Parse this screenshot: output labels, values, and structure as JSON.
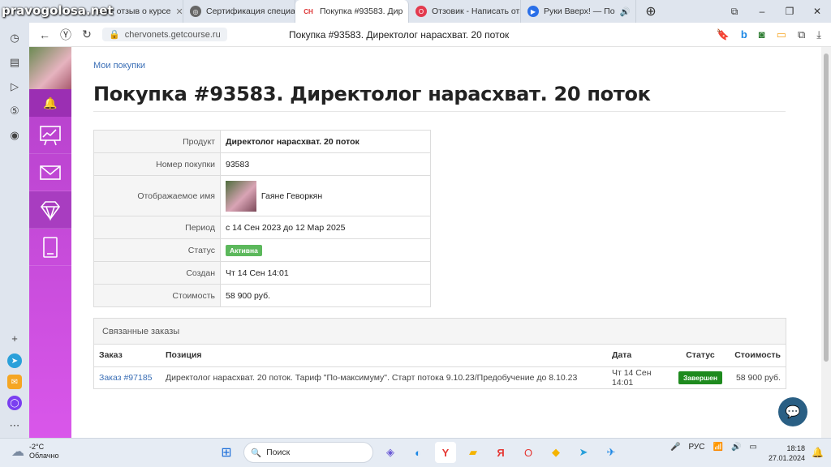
{
  "watermark": "pravogolosa.net",
  "tabs": [
    {
      "label": "вьте отзыв о курсе",
      "fav": "",
      "color": "#888"
    },
    {
      "label": "Сертификация специалиста",
      "fav": "◎",
      "color": "#555"
    },
    {
      "label": "Покупка #93583. Дир",
      "fav": "CH",
      "color": "#d33"
    },
    {
      "label": "Отзовик - Написать отз",
      "fav": "O",
      "color": "#e33a4e"
    },
    {
      "label": "Руки Вверх! — По",
      "fav": "▶",
      "color": "#2a6fe8"
    }
  ],
  "addressbar": {
    "url": "chervonets.getcourse.ru",
    "page_title": "Покупка #93583. Директолог нарасхват. 20 поток"
  },
  "page": {
    "breadcrumb": "Мои покупки",
    "title": "Покупка #93583. Директолог нарасхват. 20 поток",
    "info": {
      "product_label": "Продукт",
      "product_value": "Директолог нарасхват. 20 поток",
      "number_label": "Номер покупки",
      "number_value": "93583",
      "name_label": "Отображаемое имя",
      "name_value": "Гаяне Геворкян",
      "period_label": "Период",
      "period_value": "с 14 Сен 2023 до 12 Мар 2025",
      "status_label": "Статус",
      "status_value": "Активна",
      "created_label": "Создан",
      "created_value": "Чт 14 Сен 14:01",
      "cost_label": "Стоимость",
      "cost_value": "58 900 руб."
    },
    "related": {
      "heading": "Связанные заказы",
      "columns": [
        "Заказ",
        "Позиция",
        "Дата",
        "Статус",
        "Стоимость"
      ],
      "row": {
        "order": "Заказ #97185",
        "position": "Директолог нарасхват. 20 поток. Тариф \"По-максимуму\". Старт потока 9.10.23/Предобучение до 8.10.23",
        "date": "Чт 14 Сен 14:01",
        "status": "Завершен",
        "cost": "58 900 руб."
      }
    }
  },
  "colors": {
    "active_badge": "#5cb85c",
    "done_badge": "#1e8a1e",
    "site_sidebar": "#c84bdd",
    "link": "#3b6fb6"
  },
  "taskbar": {
    "temp": "-2°C",
    "weather": "Облачно",
    "search": "Поиск",
    "lang": "РУС",
    "time": "18:18",
    "date": "27.01.2024"
  }
}
